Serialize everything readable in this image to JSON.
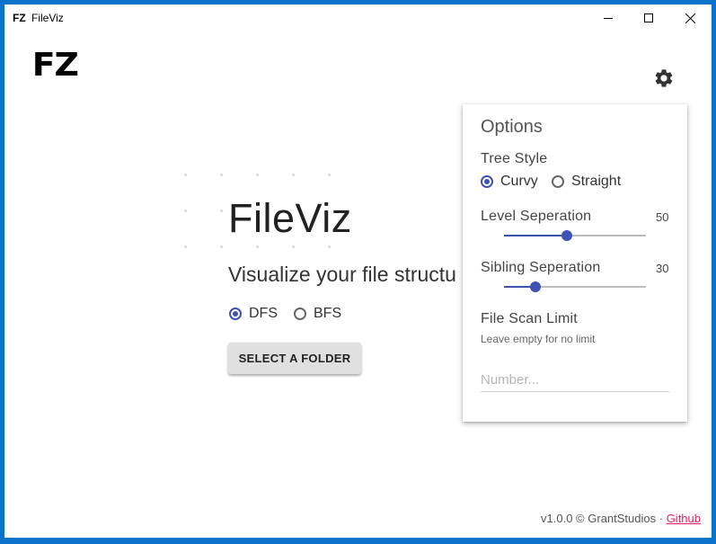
{
  "window": {
    "logo_text": "FZ",
    "title": "FileViz"
  },
  "app": {
    "logo_text": "FZ"
  },
  "hero": {
    "title": "FileViz",
    "subtitle": "Visualize your file structu",
    "search_options": [
      {
        "label": "DFS",
        "selected": true
      },
      {
        "label": "BFS",
        "selected": false
      }
    ],
    "select_button_label": "SELECT A FOLDER"
  },
  "options": {
    "title": "Options",
    "tree_style_label": "Tree Style",
    "tree_styles": [
      {
        "label": "Curvy",
        "selected": true
      },
      {
        "label": "Straight",
        "selected": false
      }
    ],
    "level_separation_label": "Level Seperation",
    "level_separation_value": "50",
    "level_separation_fraction": 0.44,
    "sibling_separation_label": "Sibling Seperation",
    "sibling_separation_value": "30",
    "sibling_separation_fraction": 0.22,
    "scan_limit_label": "File Scan Limit",
    "scan_limit_hint": "Leave empty for no limit",
    "scan_limit_placeholder": "Number...",
    "scan_limit_value": ""
  },
  "footer": {
    "version_text": "v1.0.0 © GrantStudios · ",
    "github_label": "Github"
  },
  "colors": {
    "accent": "#3f51b5",
    "link": "#e91e63",
    "desktop": "#0a73c9"
  },
  "icons": {
    "settings": "gear-icon",
    "minimize": "minimize-icon",
    "maximize": "maximize-icon",
    "close": "close-icon"
  }
}
